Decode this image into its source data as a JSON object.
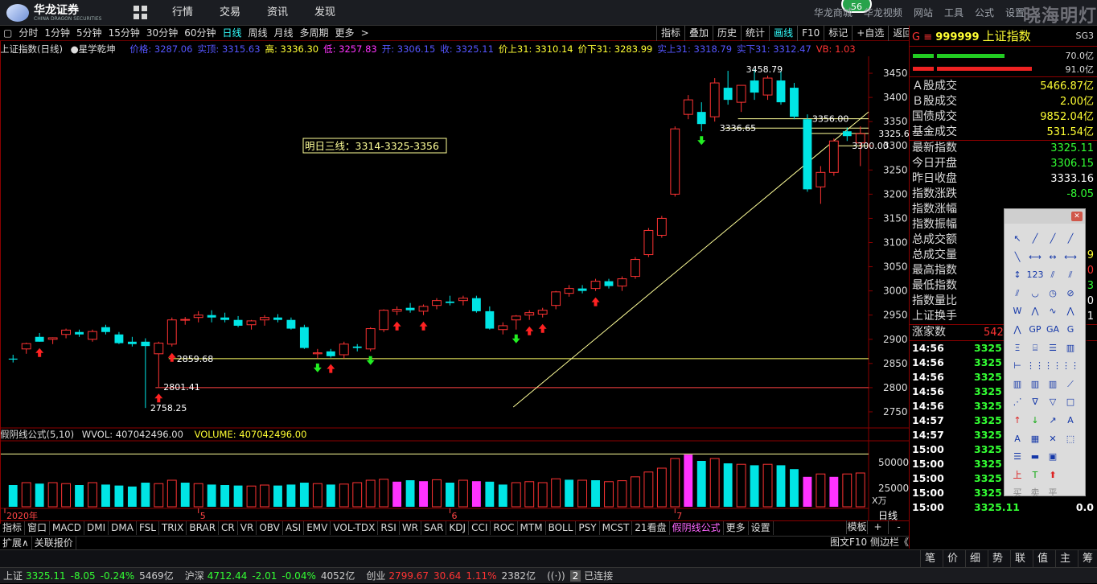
{
  "app": {
    "logo_title": "华龙证券",
    "logo_sub": "CHINA DRAGON SECURITIES",
    "watermark": "晓海明灯",
    "badge": "56"
  },
  "main_menu": [
    "行情",
    "交易",
    "资讯",
    "发现"
  ],
  "right_menu": [
    "华龙商城",
    "华龙视频",
    "网站",
    "工具",
    "公式",
    "设置"
  ],
  "period_bar": [
    "分时",
    "1分钟",
    "5分钟",
    "15分钟",
    "30分钟",
    "60分钟",
    "日线",
    "周线",
    "月线",
    "多周期",
    "更多"
  ],
  "period_active": "日线",
  "chart_tools": [
    "指标",
    "叠加",
    "历史",
    "统计",
    "画线",
    "F10",
    "标记",
    "+自选",
    "返回"
  ],
  "chart_tools_active": "画线",
  "info": {
    "name": "上证指数(日线)",
    "strategy": "●星学乾坤",
    "items": [
      {
        "t": "价格: 3287.06",
        "c": "#55f"
      },
      {
        "t": "实顶: 3315.63",
        "c": "#55f"
      },
      {
        "t": "高: 3336.30",
        "c": "#ff3"
      },
      {
        "t": "低: 3257.83",
        "c": "#f3f"
      },
      {
        "t": "开: 3306.15",
        "c": "#55f"
      },
      {
        "t": "收: 3325.11",
        "c": "#55f"
      },
      {
        "t": "价上31: 3310.14",
        "c": "#ff3"
      },
      {
        "t": "价下31: 3283.99",
        "c": "#ff3"
      },
      {
        "t": "实上31: 3318.79",
        "c": "#55f"
      },
      {
        "t": "实下31: 3312.47",
        "c": "#55f"
      },
      {
        "t": "VB: 1.03",
        "c": "#f33"
      }
    ]
  },
  "chart_data": {
    "type": "candlestick",
    "price_axis": {
      "ticks": [
        3450,
        3400,
        3350,
        3300,
        3250,
        3200,
        3150,
        3100,
        3050,
        3000,
        2950,
        2900,
        2850,
        2800,
        2750
      ],
      "min": 2720,
      "max": 3485
    },
    "annotation_box": "明日三线：3314-3325-3356",
    "price_labels": [
      {
        "text": "3458.79",
        "price": 3458.79,
        "idx": 55
      },
      {
        "text": "2758.25",
        "price": 2758.25,
        "idx": 10
      },
      {
        "text": "2859.68",
        "price": 2859.68,
        "idx": 12
      },
      {
        "text": "2801.41",
        "price": 2801.41,
        "idx": 11
      },
      {
        "text": "3336.65",
        "price": 3336.65,
        "idx": 53
      },
      {
        "text": "3356.00",
        "price": 3356.0,
        "idx": 60
      },
      {
        "text": "3325.60",
        "price": 3325.6,
        "idx": 65
      },
      {
        "text": "3300.00",
        "price": 3300.0,
        "idx": 63
      }
    ],
    "hlines": [
      {
        "price": 2860,
        "color": "#ffff66",
        "from": 12
      },
      {
        "price": 2800,
        "color": "#ff4444",
        "from": 11
      },
      {
        "price": 3356,
        "color": "#ffff99",
        "from": 55
      },
      {
        "price": 3336.65,
        "color": "#ffff99",
        "from": 54
      },
      {
        "price": 3325.6,
        "color": "#ffff99",
        "from": 60
      },
      {
        "price": 3300,
        "color": "#ffff99",
        "from": 62
      }
    ],
    "trendline": {
      "from": {
        "idx": 39,
        "price": 2760
      },
      "to": {
        "idx": 69,
        "price": 3370
      }
    },
    "candles": [
      {
        "o": 2860,
        "h": 2868,
        "l": 2852,
        "c": 2858
      },
      {
        "o": 2880,
        "h": 2893,
        "l": 2870,
        "c": 2891
      },
      {
        "o": 2905,
        "h": 2913,
        "l": 2895,
        "c": 2895
      },
      {
        "o": 2900,
        "h": 2904,
        "l": 2890,
        "c": 2903
      },
      {
        "o": 2910,
        "h": 2922,
        "l": 2902,
        "c": 2919
      },
      {
        "o": 2915,
        "h": 2920,
        "l": 2905,
        "c": 2910
      },
      {
        "o": 2900,
        "h": 2920,
        "l": 2895,
        "c": 2916
      },
      {
        "o": 2925,
        "h": 2930,
        "l": 2910,
        "c": 2915
      },
      {
        "o": 2910,
        "h": 2915,
        "l": 2890,
        "c": 2892
      },
      {
        "o": 2895,
        "h": 2905,
        "l": 2885,
        "c": 2890
      },
      {
        "o": 2895,
        "h": 2902,
        "l": 2758,
        "c": 2886
      },
      {
        "o": 2870,
        "h": 2895,
        "l": 2801,
        "c": 2892
      },
      {
        "o": 2890,
        "h": 2945,
        "l": 2885,
        "c": 2940
      },
      {
        "o": 2940,
        "h": 2946,
        "l": 2930,
        "c": 2941
      },
      {
        "o": 2945,
        "h": 2958,
        "l": 2935,
        "c": 2950
      },
      {
        "o": 2950,
        "h": 2960,
        "l": 2935,
        "c": 2945
      },
      {
        "o": 2945,
        "h": 2955,
        "l": 2935,
        "c": 2940
      },
      {
        "o": 2940,
        "h": 2948,
        "l": 2925,
        "c": 2928
      },
      {
        "o": 2930,
        "h": 2940,
        "l": 2920,
        "c": 2938
      },
      {
        "o": 2940,
        "h": 2950,
        "l": 2928,
        "c": 2945
      },
      {
        "o": 2945,
        "h": 2952,
        "l": 2935,
        "c": 2940
      },
      {
        "o": 2940,
        "h": 2945,
        "l": 2920,
        "c": 2922
      },
      {
        "o": 2925,
        "h": 2930,
        "l": 2880,
        "c": 2882
      },
      {
        "o": 2870,
        "h": 2880,
        "l": 2860,
        "c": 2872
      },
      {
        "o": 2875,
        "h": 2880,
        "l": 2862,
        "c": 2865
      },
      {
        "o": 2868,
        "h": 2895,
        "l": 2860,
        "c": 2890
      },
      {
        "o": 2885,
        "h": 2890,
        "l": 2875,
        "c": 2882
      },
      {
        "o": 2880,
        "h": 2925,
        "l": 2875,
        "c": 2922
      },
      {
        "o": 2920,
        "h": 2962,
        "l": 2915,
        "c": 2960
      },
      {
        "o": 2958,
        "h": 2968,
        "l": 2950,
        "c": 2962
      },
      {
        "o": 2965,
        "h": 2975,
        "l": 2955,
        "c": 2960
      },
      {
        "o": 2958,
        "h": 2972,
        "l": 2950,
        "c": 2968
      },
      {
        "o": 2970,
        "h": 2985,
        "l": 2962,
        "c": 2980
      },
      {
        "o": 2978,
        "h": 2990,
        "l": 2970,
        "c": 2975
      },
      {
        "o": 2980,
        "h": 2990,
        "l": 2970,
        "c": 2985
      },
      {
        "o": 2985,
        "h": 2990,
        "l": 2955,
        "c": 2958
      },
      {
        "o": 2958,
        "h": 2968,
        "l": 2920,
        "c": 2922
      },
      {
        "o": 2920,
        "h": 2935,
        "l": 2910,
        "c": 2928
      },
      {
        "o": 2940,
        "h": 2950,
        "l": 2920,
        "c": 2948
      },
      {
        "o": 2950,
        "h": 2960,
        "l": 2940,
        "c": 2955
      },
      {
        "o": 2952,
        "h": 2965,
        "l": 2945,
        "c": 2960
      },
      {
        "o": 2970,
        "h": 3000,
        "l": 2962,
        "c": 2998
      },
      {
        "o": 2995,
        "h": 3012,
        "l": 2988,
        "c": 3005
      },
      {
        "o": 3005,
        "h": 3012,
        "l": 2995,
        "c": 3000
      },
      {
        "o": 3005,
        "h": 3025,
        "l": 3000,
        "c": 3020
      },
      {
        "o": 3020,
        "h": 3025,
        "l": 3005,
        "c": 3010
      },
      {
        "o": 3010,
        "h": 3030,
        "l": 3000,
        "c": 3025
      },
      {
        "o": 3030,
        "h": 3070,
        "l": 3025,
        "c": 3065
      },
      {
        "o": 3075,
        "h": 3130,
        "l": 3070,
        "c": 3125
      },
      {
        "o": 3115,
        "h": 3155,
        "l": 3110,
        "c": 3150
      },
      {
        "o": 3200,
        "h": 3340,
        "l": 3195,
        "c": 3335
      },
      {
        "o": 3365,
        "h": 3405,
        "l": 3355,
        "c": 3395
      },
      {
        "o": 3370,
        "h": 3390,
        "l": 3330,
        "c": 3345
      },
      {
        "o": 3360,
        "h": 3440,
        "l": 3350,
        "c": 3430
      },
      {
        "o": 3420,
        "h": 3455,
        "l": 3385,
        "c": 3395
      },
      {
        "o": 3390,
        "h": 3425,
        "l": 3370,
        "c": 3425
      },
      {
        "o": 3435,
        "h": 3458,
        "l": 3395,
        "c": 3410
      },
      {
        "o": 3405,
        "h": 3445,
        "l": 3395,
        "c": 3440
      },
      {
        "o": 3435,
        "h": 3455,
        "l": 3385,
        "c": 3390
      },
      {
        "o": 3420,
        "h": 3430,
        "l": 3355,
        "c": 3360
      },
      {
        "o": 3355,
        "h": 3365,
        "l": 3205,
        "c": 3210
      },
      {
        "o": 3215,
        "h": 3258,
        "l": 3180,
        "c": 3245
      },
      {
        "o": 3245,
        "h": 3315,
        "l": 3238,
        "c": 3310
      },
      {
        "o": 3330,
        "h": 3338,
        "l": 3310,
        "c": 3320
      },
      {
        "o": 3306,
        "h": 3340,
        "l": 3258,
        "c": 3325
      }
    ],
    "volume": {
      "label": "假阴线公式(5,10)",
      "wvol": "WVOL: 407042496.00",
      "vol": "VOLUME: 407042496.00",
      "ticks": [
        "50000",
        "25000"
      ],
      "unit": "X万",
      "bars": [
        {
          "v": 0.45,
          "t": "c"
        },
        {
          "v": 0.5,
          "t": "r"
        },
        {
          "v": 0.48,
          "t": "c"
        },
        {
          "v": 0.5,
          "t": "r"
        },
        {
          "v": 0.48,
          "t": "r"
        },
        {
          "v": 0.45,
          "t": "c"
        },
        {
          "v": 0.5,
          "t": "r"
        },
        {
          "v": 0.46,
          "t": "c"
        },
        {
          "v": 0.44,
          "t": "c"
        },
        {
          "v": 0.42,
          "t": "c"
        },
        {
          "v": 0.5,
          "t": "c"
        },
        {
          "v": 0.48,
          "t": "r"
        },
        {
          "v": 0.55,
          "t": "r"
        },
        {
          "v": 0.5,
          "t": "c"
        },
        {
          "v": 0.48,
          "t": "r"
        },
        {
          "v": 0.46,
          "t": "c"
        },
        {
          "v": 0.45,
          "t": "c"
        },
        {
          "v": 0.44,
          "t": "c"
        },
        {
          "v": 0.43,
          "t": "r"
        },
        {
          "v": 0.45,
          "t": "r"
        },
        {
          "v": 0.44,
          "t": "c"
        },
        {
          "v": 0.46,
          "t": "c"
        },
        {
          "v": 0.5,
          "t": "c"
        },
        {
          "v": 0.48,
          "t": "r"
        },
        {
          "v": 0.46,
          "t": "c"
        },
        {
          "v": 0.47,
          "t": "r"
        },
        {
          "v": 0.5,
          "t": "r"
        },
        {
          "v": 0.55,
          "t": "r"
        },
        {
          "v": 0.57,
          "t": "r"
        },
        {
          "v": 0.52,
          "t": "m"
        },
        {
          "v": 0.55,
          "t": "c"
        },
        {
          "v": 0.53,
          "t": "m"
        },
        {
          "v": 0.56,
          "t": "r"
        },
        {
          "v": 0.5,
          "t": "c"
        },
        {
          "v": 0.55,
          "t": "r"
        },
        {
          "v": 0.53,
          "t": "m"
        },
        {
          "v": 0.52,
          "t": "c"
        },
        {
          "v": 0.46,
          "t": "c"
        },
        {
          "v": 0.5,
          "t": "r"
        },
        {
          "v": 0.52,
          "t": "r"
        },
        {
          "v": 0.5,
          "t": "r"
        },
        {
          "v": 0.58,
          "t": "r"
        },
        {
          "v": 0.56,
          "t": "c"
        },
        {
          "v": 0.55,
          "t": "r"
        },
        {
          "v": 0.55,
          "t": "c"
        },
        {
          "v": 0.52,
          "t": "r"
        },
        {
          "v": 0.54,
          "t": "r"
        },
        {
          "v": 0.62,
          "t": "r"
        },
        {
          "v": 0.72,
          "t": "r"
        },
        {
          "v": 0.8,
          "t": "r"
        },
        {
          "v": 1.0,
          "t": "r"
        },
        {
          "v": 1.08,
          "t": "m"
        },
        {
          "v": 0.95,
          "t": "c"
        },
        {
          "v": 1.0,
          "t": "r"
        },
        {
          "v": 0.9,
          "t": "c"
        },
        {
          "v": 0.88,
          "t": "r"
        },
        {
          "v": 0.86,
          "t": "c"
        },
        {
          "v": 0.88,
          "t": "r"
        },
        {
          "v": 0.86,
          "t": "c"
        },
        {
          "v": 0.78,
          "t": "c"
        },
        {
          "v": 0.62,
          "t": "m"
        },
        {
          "v": 0.68,
          "t": "r"
        },
        {
          "v": 0.62,
          "t": "m"
        },
        {
          "v": 0.68,
          "t": "r"
        },
        {
          "v": 0.7,
          "t": "r"
        }
      ]
    },
    "date_ticks": [
      {
        "text": "2020年",
        "idx": 0
      },
      {
        "text": "5",
        "idx": 14
      },
      {
        "text": "6",
        "idx": 33
      },
      {
        "text": "7",
        "idx": 50
      }
    ],
    "period_label": "日线",
    "arrows": [
      {
        "idx": 2,
        "dir": "up"
      },
      {
        "idx": 11,
        "dir": "up"
      },
      {
        "idx": 12,
        "dir": "up"
      },
      {
        "idx": 23,
        "dir": "down"
      },
      {
        "idx": 24,
        "dir": "up"
      },
      {
        "idx": 27,
        "dir": "down"
      },
      {
        "idx": 29,
        "dir": "up"
      },
      {
        "idx": 31,
        "dir": "up"
      },
      {
        "idx": 38,
        "dir": "down"
      },
      {
        "idx": 39,
        "dir": "up"
      },
      {
        "idx": 40,
        "dir": "up"
      },
      {
        "idx": 44,
        "dir": "up"
      },
      {
        "idx": 52,
        "dir": "down"
      }
    ]
  },
  "bottom_tabs": [
    "指标",
    "窗口",
    "MACD",
    "DMI",
    "DMA",
    "FSL",
    "TRIX",
    "BRAR",
    "CR",
    "VR",
    "OBV",
    "ASI",
    "EMV",
    "VOL-TDX",
    "RSI",
    "WR",
    "SAR",
    "KDJ",
    "CCI",
    "ROC",
    "MTM",
    "BOLL",
    "PSY",
    "MCST",
    "21看盘",
    "假阴线公式",
    "更多",
    "设置"
  ],
  "bottom_tabs_active": "假阴线公式",
  "bottom_right": [
    "模板",
    "+",
    "-"
  ],
  "extension_bar": [
    "扩展∧",
    "关联报价"
  ],
  "extension_right": "图文F10",
  "side_column_label": "侧边栏《",
  "right_panel": {
    "symbol_code": "999999",
    "symbol_name": "上证指数",
    "prefix": "G ≡",
    "code_tag": "SG3",
    "ratios": [
      "70.0亿",
      "91.0亿"
    ],
    "turnover": [
      {
        "label": "Ａ股成交",
        "value": "5466.87亿"
      },
      {
        "label": "Ｂ股成交",
        "value": "2.00亿"
      },
      {
        "label": "国债成交",
        "value": "9852.04亿"
      },
      {
        "label": "基金成交",
        "value": "531.54亿"
      }
    ],
    "stats": [
      {
        "label": "最新指数",
        "value": "3325.11",
        "c": "green"
      },
      {
        "label": "今日开盘",
        "value": "3306.15",
        "c": "green"
      },
      {
        "label": "昨日收盘",
        "value": "3333.16",
        "c": "white"
      },
      {
        "label": "指数涨跌",
        "value": "-8.05",
        "c": "green"
      },
      {
        "label": "指数涨幅",
        "value": "",
        "c": "green"
      },
      {
        "label": "指数振幅",
        "value": "",
        "c": "white"
      },
      {
        "label": "总成交额",
        "value": "",
        "c": "white"
      },
      {
        "label": "总成交量",
        "value": "9",
        "c": "yellow"
      },
      {
        "label": "最高指数",
        "value": "0",
        "c": "red"
      },
      {
        "label": "最低指数",
        "value": "3",
        "c": "green"
      },
      {
        "label": "指数量比",
        "value": "0",
        "c": "white"
      },
      {
        "label": "上证换手",
        "value": "1",
        "c": "white"
      }
    ],
    "up_count_label": "涨家数",
    "up_count_value": "542",
    "ticks": [
      {
        "t": "14:56",
        "p": "3325",
        "v": ""
      },
      {
        "t": "14:56",
        "p": "3325",
        "v": ""
      },
      {
        "t": "14:56",
        "p": "3325",
        "v": ""
      },
      {
        "t": "14:56",
        "p": "3325",
        "v": ""
      },
      {
        "t": "14:56",
        "p": "3325",
        "v": ""
      },
      {
        "t": "14:57",
        "p": "3325",
        "v": ""
      },
      {
        "t": "14:57",
        "p": "3325",
        "v": ""
      },
      {
        "t": "15:00",
        "p": "3325",
        "v": ""
      },
      {
        "t": "15:00",
        "p": "3325",
        "v": ""
      },
      {
        "t": "15:00",
        "p": "3325",
        "v": ""
      },
      {
        "t": "15:00",
        "p": "3325",
        "v": ""
      },
      {
        "t": "15:00",
        "p": "3325.11",
        "v": "0.0"
      }
    ],
    "bottom_tabs": [
      "笔",
      "价",
      "细",
      "势",
      "联",
      "值",
      "主",
      "筹"
    ]
  },
  "status_bar": {
    "items": [
      {
        "name": "上证",
        "value": "3325.11",
        "chg": "-8.05",
        "pct": "-0.24%",
        "amt": "5469亿",
        "dir": "down"
      },
      {
        "name": "沪深",
        "value": "4712.44",
        "chg": "-2.01",
        "pct": "-0.04%",
        "amt": "4052亿",
        "dir": "down"
      },
      {
        "name": "创业",
        "value": "2799.67",
        "chg": "30.64",
        "pct": "1.11%",
        "amt": "2382亿",
        "dir": "up"
      }
    ],
    "connection": "已连接",
    "conn_count": "2"
  },
  "draw_tools": [
    "↖",
    "╱",
    "╱",
    "╱",
    "╲",
    "⟷",
    "↔",
    "⟷",
    "↕",
    "123",
    "⫽",
    "⫽",
    "⫽",
    "◡",
    "◷",
    "⊘",
    "W",
    "⋀",
    "∿",
    "⋀",
    "⋀",
    "GP",
    "GA",
    "G",
    "Ξ",
    "⌸",
    "☰",
    "▥",
    "⊢",
    "⋮⋮",
    "⋮⋮",
    "⋮⋮",
    "▥",
    "▥",
    "▥",
    "⟋",
    "⋰",
    "∇",
    "▽",
    "□",
    "↑",
    "↓",
    "↗",
    "A",
    "A",
    "▦",
    "✕",
    "⬚",
    "☰",
    "▬",
    "▣",
    "",
    "上",
    "T",
    "⬆",
    ""
  ],
  "draw_tools_footer": [
    "买",
    "卖",
    "平"
  ],
  "colors": {
    "up": "#ff3333",
    "down": "#00e5e5",
    "accent": "#8b0000",
    "magenta": "#ff33ff"
  }
}
